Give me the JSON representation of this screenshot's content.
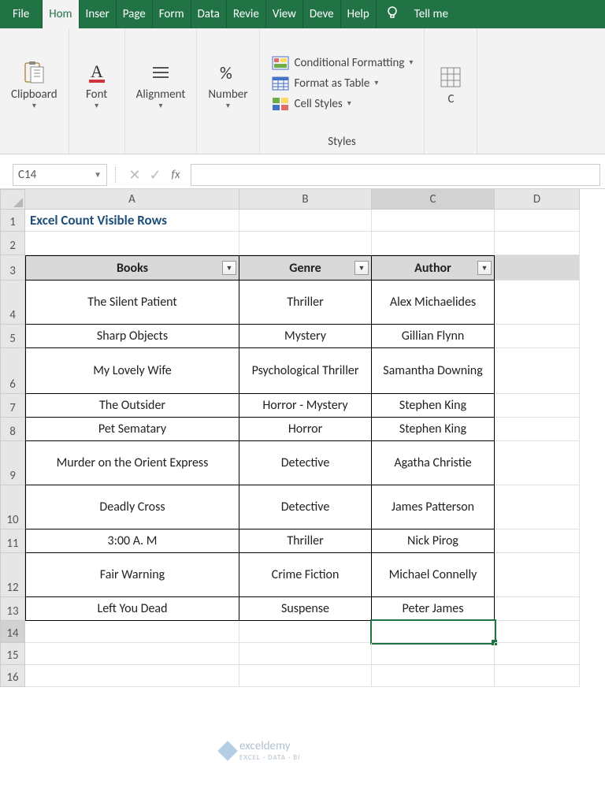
{
  "tabs": {
    "file": "File",
    "home": "Hom",
    "insert": "Inser",
    "page": "Page",
    "form": "Form",
    "data": "Data",
    "review": "Revie",
    "view": "View",
    "dev": "Deve",
    "help": "Help",
    "tellme": "Tell me"
  },
  "ribbon": {
    "clipboard": "Clipboard",
    "font": "Font",
    "alignment": "Alignment",
    "number": "Number",
    "styles": "Styles",
    "cond_format": "Conditional Formatting",
    "format_table": "Format as Table",
    "cell_styles": "Cell Styles",
    "cells_right": "C"
  },
  "namebox": "C14",
  "formula": "",
  "fx": "fx",
  "columns": {
    "A": "A",
    "B": "B",
    "C": "C",
    "D": "D"
  },
  "title": "Excel Count Visible Rows",
  "headers": {
    "books": "Books",
    "genre": "Genre",
    "author": "Author"
  },
  "rows": [
    {
      "book": "The Silent Patient",
      "genre": "Thriller",
      "author": "Alex Michaelides"
    },
    {
      "book": "Sharp Objects",
      "genre": "Mystery",
      "author": "Gillian Flynn"
    },
    {
      "book": "My Lovely Wife",
      "genre": "Psychological Thriller",
      "author": "Samantha Downing"
    },
    {
      "book": "The Outsider",
      "genre": "Horror - Mystery",
      "author": "Stephen King"
    },
    {
      "book": "Pet Sematary",
      "genre": "Horror",
      "author": "Stephen King"
    },
    {
      "book": "Murder on the Orient Express",
      "genre": "Detective",
      "author": "Agatha Christie"
    },
    {
      "book": "Deadly Cross",
      "genre": "Detective",
      "author": "James Patterson"
    },
    {
      "book": "3:00 A. M",
      "genre": "Thriller",
      "author": "Nick Pirog"
    },
    {
      "book": "Fair Warning",
      "genre": "Crime Fiction",
      "author": "Michael Connelly"
    },
    {
      "book": "Left You Dead",
      "genre": "Suspense",
      "author": "Peter James"
    }
  ],
  "row_labels": [
    "1",
    "2",
    "3",
    "4",
    "5",
    "6",
    "7",
    "8",
    "9",
    "10",
    "11",
    "12",
    "13",
    "14",
    "15",
    "16"
  ],
  "watermark": {
    "name": "exceldemy",
    "sub": "EXCEL · DATA · BI"
  }
}
